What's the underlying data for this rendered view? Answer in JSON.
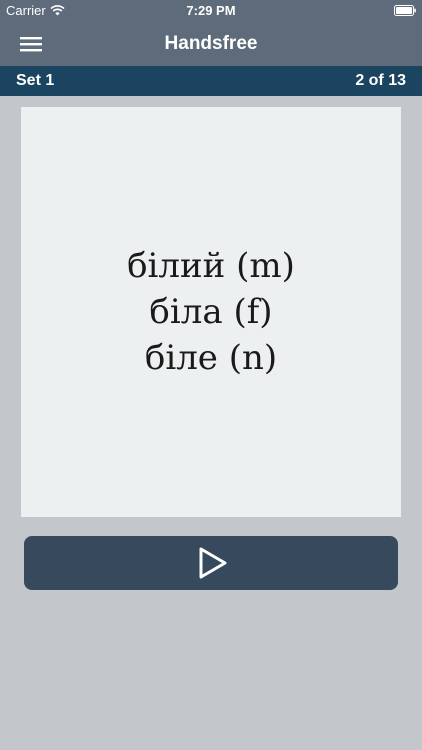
{
  "status_bar": {
    "carrier": "Carrier",
    "time": "7:29 PM"
  },
  "nav": {
    "title": "Handsfree"
  },
  "set_bar": {
    "set_name": "Set 1",
    "progress": "2 of 13"
  },
  "card": {
    "lines": [
      "білий (m)",
      "біла (f)",
      "біле (n)"
    ]
  },
  "icons": {
    "menu": "hamburger-menu-icon",
    "play": "play-icon",
    "wifi": "wifi-icon",
    "battery": "battery-icon"
  },
  "colors": {
    "nav_background": "#5d6b7a",
    "set_bar_background": "#1b4460",
    "page_background": "#c3c7cb",
    "card_background": "#edf0f1",
    "play_button_background": "#36495d"
  }
}
